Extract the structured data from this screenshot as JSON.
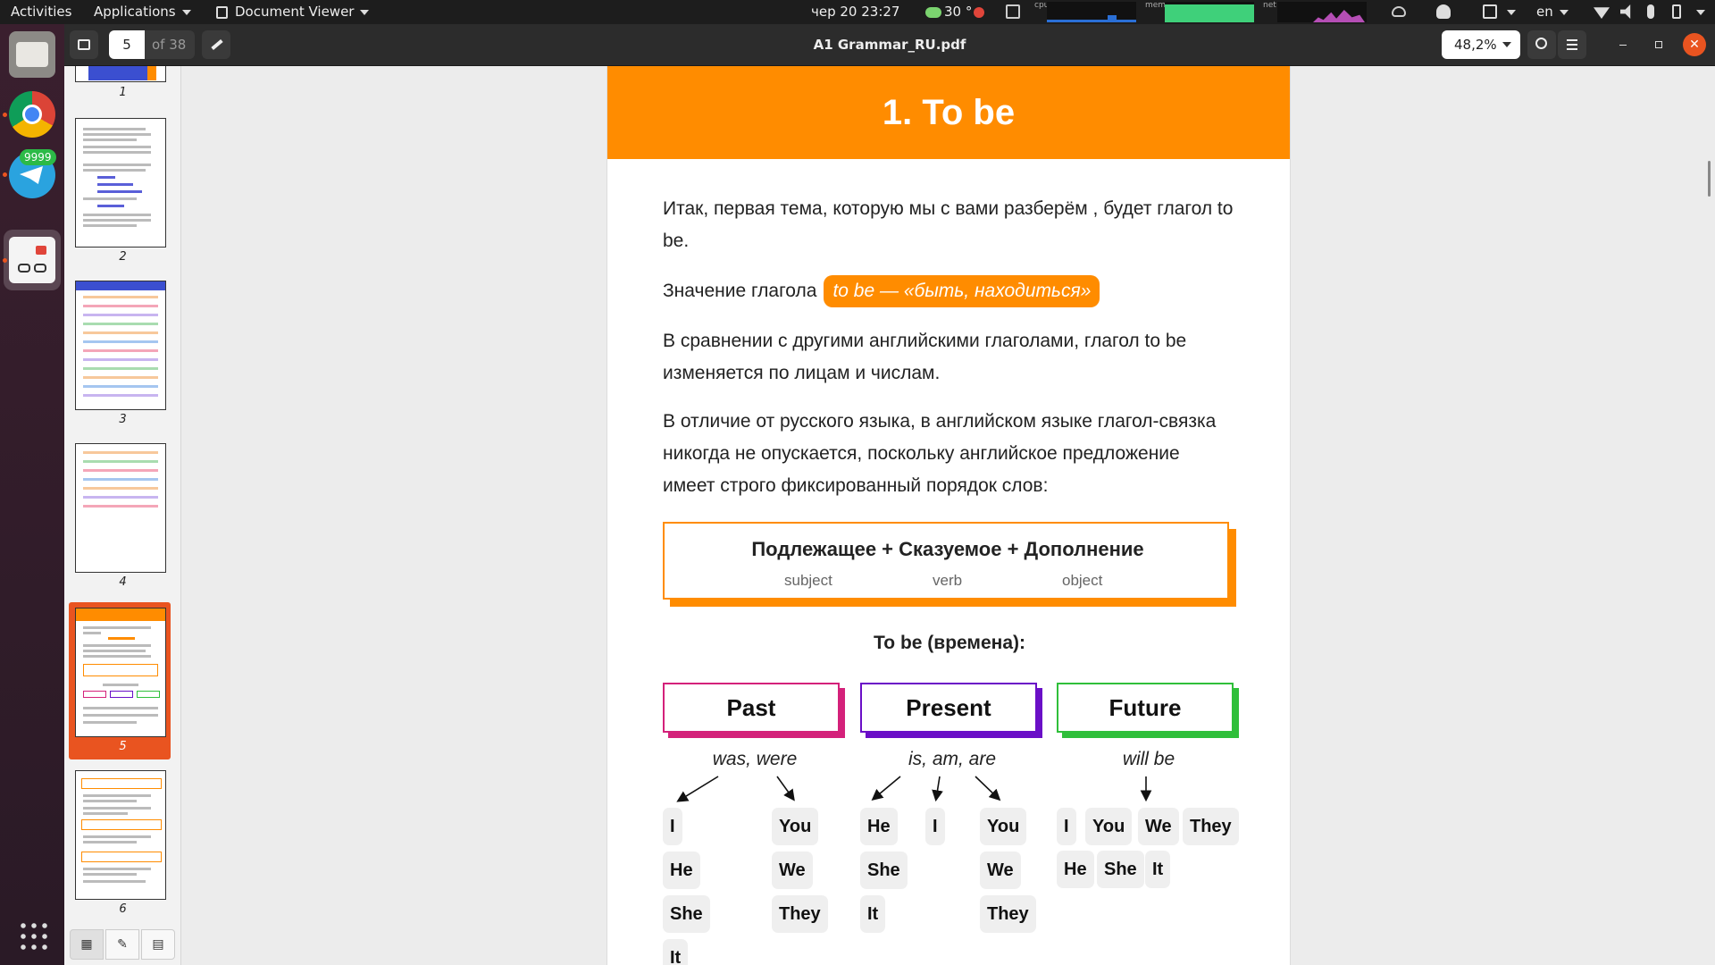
{
  "topbar": {
    "activities": "Activities",
    "applications": "Applications",
    "app_name": "Document Viewer",
    "datetime": "чер 20  23:27",
    "weather": "30 °",
    "cpu_label": "cpu",
    "mem_label": "mem",
    "net_label": "net",
    "lang": "en"
  },
  "dock": {
    "telegram_badge": "9999",
    "items": [
      "files",
      "chrome",
      "telegram",
      "document-viewer"
    ]
  },
  "header": {
    "page_current": "5",
    "page_total": "of 38",
    "title": "A1 Grammar_RU.pdf",
    "zoom": "48,2%"
  },
  "sidebar": {
    "thumb_labels": [
      "1",
      "2",
      "3",
      "4",
      "5",
      "6"
    ],
    "selected_page": "5"
  },
  "page": {
    "banner": "1.  To be",
    "p1": "Итак, первая тема, которую мы с вами разберём , будет глагол to be.",
    "p2_text": "Значение глагола",
    "p2_pill": "to be — «быть, находиться»",
    "p3": "В сравнении с  другими английскими глаголами, глагол to be изменяется по лицам и числам.",
    "p4": "В отличие от русского языка, в английском языке глагол-связка никогда не опускается, поскольку английское предложение имеет строго фиксированный порядок слов:",
    "formula_title": "Подлежащее  + Сказуемое + Дополнение",
    "formula_subject": "subject",
    "formula_verb": "verb",
    "formula_object": "object",
    "tenses_heading": "To be (времена):",
    "tenses": [
      {
        "name": "Past",
        "forms": "was, were",
        "color": "#d4217a"
      },
      {
        "name": "Present",
        "forms": "is, am, are",
        "color": "#6a0fc7"
      },
      {
        "name": "Future",
        "forms": "will be",
        "color": "#2fbf3a"
      }
    ],
    "past_left": [
      "I",
      "He",
      "She",
      "It"
    ],
    "past_right": [
      "You",
      "We",
      "They"
    ],
    "present_he": [
      "He",
      "She",
      "It"
    ],
    "present_i": "I",
    "present_you": [
      "You",
      "We",
      "They"
    ],
    "future_row1": [
      "I",
      "You",
      "We",
      "They"
    ],
    "future_row2": [
      "He",
      "She",
      "It"
    ]
  }
}
